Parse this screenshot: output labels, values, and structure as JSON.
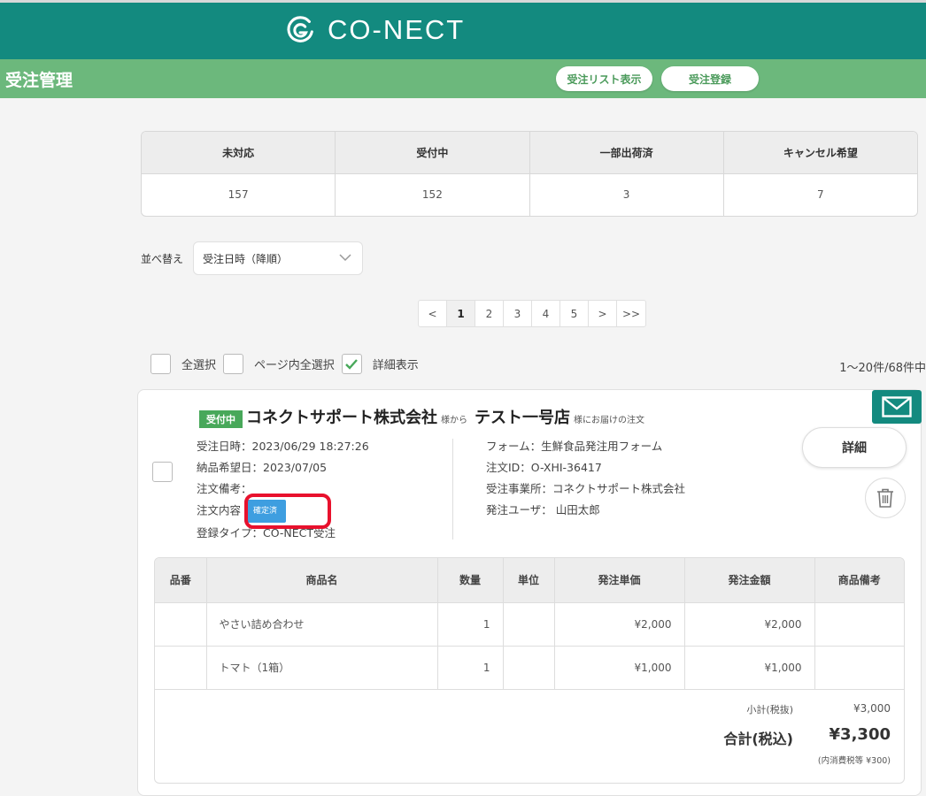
{
  "header": {
    "logo_text": "CO-NECT"
  },
  "subheader": {
    "title": "受注管理",
    "list_button": "受注リスト表示",
    "register_button": "受注登録"
  },
  "status_summary": {
    "headers": [
      "未対応",
      "受付中",
      "一部出荷済",
      "キャンセル希望"
    ],
    "values": [
      "157",
      "152",
      "3",
      "7"
    ]
  },
  "sort": {
    "label": "並べ替え",
    "value": "受注日時（降順）"
  },
  "pagination": {
    "prev": "<",
    "pages": [
      "1",
      "2",
      "3",
      "4",
      "5"
    ],
    "current": "1",
    "next": ">",
    "last": ">>"
  },
  "selection": {
    "select_all": "全選択",
    "select_page": "ページ内全選択",
    "show_detail": "詳細表示",
    "show_detail_checked": true,
    "count_text": "1〜20件/68件中"
  },
  "order": {
    "status": "受付中",
    "company": "コネクトサポート株式会社",
    "from_suffix": "様から",
    "shop": "テスト一号店",
    "to_suffix": "様にお届けの注文",
    "order_date": "受注日時：2023/06/29 18:27:26",
    "delivery_date": "納品希望日：2023/07/05",
    "note": "注文備考：",
    "content_label": "注文内容",
    "content_badge": "確定済",
    "register_type": "登録タイプ：CO-NECT受注",
    "form": "フォーム：生鮮食品発注用フォーム",
    "order_id": "注文ID：O-XHI-36417",
    "office": "受注事業所：コネクトサポート株式会社",
    "user": "発注ユーザ： 山田太郎",
    "detail_button": "詳細",
    "items_headers": [
      "品番",
      "商品名",
      "数量",
      "単位",
      "発注単価",
      "発注金額",
      "商品備考"
    ],
    "items": [
      {
        "code": "",
        "name": "やさい詰め合わせ",
        "qty": "1",
        "unit": "",
        "price": "¥2,000",
        "amount": "¥2,000",
        "note": ""
      },
      {
        "code": "",
        "name": "トマト（1箱）",
        "qty": "1",
        "unit": "",
        "price": "¥1,000",
        "amount": "¥1,000",
        "note": ""
      }
    ],
    "subtotal_label": "小計(税抜)",
    "subtotal_value": "¥3,000",
    "total_label": "合計(税込)",
    "total_value": "¥3,300",
    "tax_note": "(内消費税等 ¥300)"
  },
  "colors": {
    "brand": "#138a7f",
    "subbar": "#6cb87c",
    "highlight": "#e8112d",
    "confirm_badge": "#3e9ee0"
  }
}
